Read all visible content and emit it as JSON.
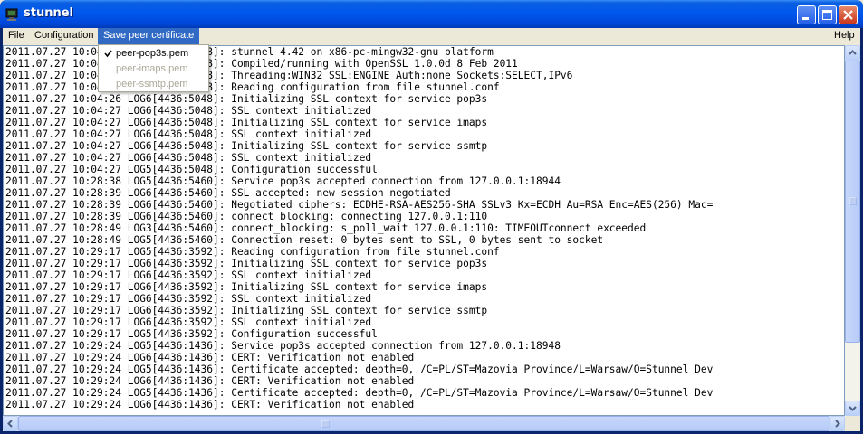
{
  "window": {
    "title": "stunnel"
  },
  "menubar": {
    "file": "File",
    "configuration": "Configuration",
    "save_peer": "Save peer certificate",
    "help": "Help"
  },
  "dropdown": {
    "items": [
      {
        "label": "peer-pop3s.pem",
        "checked": true,
        "enabled": true
      },
      {
        "label": "peer-imaps.pem",
        "checked": false,
        "enabled": false
      },
      {
        "label": "peer-ssmtp.pem",
        "checked": false,
        "enabled": false
      }
    ]
  },
  "log": [
    "2011.07.27 10:04:26 LOG5[4436:5048]: stunnel 4.42 on x86-pc-mingw32-gnu platform",
    "2011.07.27 10:04:26 LOG5[4436:5048]: Compiled/running with OpenSSL 1.0.0d 8 Feb 2011",
    "2011.07.27 10:04:26 LOG5[4436:5048]: Threading:WIN32 SSL:ENGINE Auth:none Sockets:SELECT,IPv6",
    "2011.07.27 10:04:26 LOG5[4436:5048]: Reading configuration from file stunnel.conf",
    "2011.07.27 10:04:26 LOG6[4436:5048]: Initializing SSL context for service pop3s",
    "2011.07.27 10:04:27 LOG6[4436:5048]: SSL context initialized",
    "2011.07.27 10:04:27 LOG6[4436:5048]: Initializing SSL context for service imaps",
    "2011.07.27 10:04:27 LOG6[4436:5048]: SSL context initialized",
    "2011.07.27 10:04:27 LOG6[4436:5048]: Initializing SSL context for service ssmtp",
    "2011.07.27 10:04:27 LOG6[4436:5048]: SSL context initialized",
    "2011.07.27 10:04:27 LOG5[4436:5048]: Configuration successful",
    "2011.07.27 10:28:38 LOG5[4436:5460]: Service pop3s accepted connection from 127.0.0.1:18944",
    "2011.07.27 10:28:39 LOG6[4436:5460]: SSL accepted: new session negotiated",
    "2011.07.27 10:28:39 LOG6[4436:5460]: Negotiated ciphers: ECDHE-RSA-AES256-SHA SSLv3 Kx=ECDH Au=RSA Enc=AES(256) Mac=",
    "2011.07.27 10:28:39 LOG6[4436:5460]: connect_blocking: connecting 127.0.0.1:110",
    "2011.07.27 10:28:49 LOG3[4436:5460]: connect_blocking: s_poll_wait 127.0.0.1:110: TIMEOUTconnect exceeded",
    "2011.07.27 10:28:49 LOG5[4436:5460]: Connection reset: 0 bytes sent to SSL, 0 bytes sent to socket",
    "2011.07.27 10:29:17 LOG5[4436:3592]: Reading configuration from file stunnel.conf",
    "2011.07.27 10:29:17 LOG6[4436:3592]: Initializing SSL context for service pop3s",
    "2011.07.27 10:29:17 LOG6[4436:3592]: SSL context initialized",
    "2011.07.27 10:29:17 LOG6[4436:3592]: Initializing SSL context for service imaps",
    "2011.07.27 10:29:17 LOG6[4436:3592]: SSL context initialized",
    "2011.07.27 10:29:17 LOG6[4436:3592]: Initializing SSL context for service ssmtp",
    "2011.07.27 10:29:17 LOG6[4436:3592]: SSL context initialized",
    "2011.07.27 10:29:17 LOG5[4436:3592]: Configuration successful",
    "2011.07.27 10:29:24 LOG5[4436:1436]: Service pop3s accepted connection from 127.0.0.1:18948",
    "2011.07.27 10:29:24 LOG6[4436:1436]: CERT: Verification not enabled",
    "2011.07.27 10:29:24 LOG5[4436:1436]: Certificate accepted: depth=0, /C=PL/ST=Mazovia Province/L=Warsaw/O=Stunnel Dev",
    "2011.07.27 10:29:24 LOG6[4436:1436]: CERT: Verification not enabled",
    "2011.07.27 10:29:24 LOG5[4436:1436]: Certificate accepted: depth=0, /C=PL/ST=Mazovia Province/L=Warsaw/O=Stunnel Dev",
    "2011.07.27 10:29:24 LOG6[4436:1436]: CERT: Verification not enabled"
  ]
}
